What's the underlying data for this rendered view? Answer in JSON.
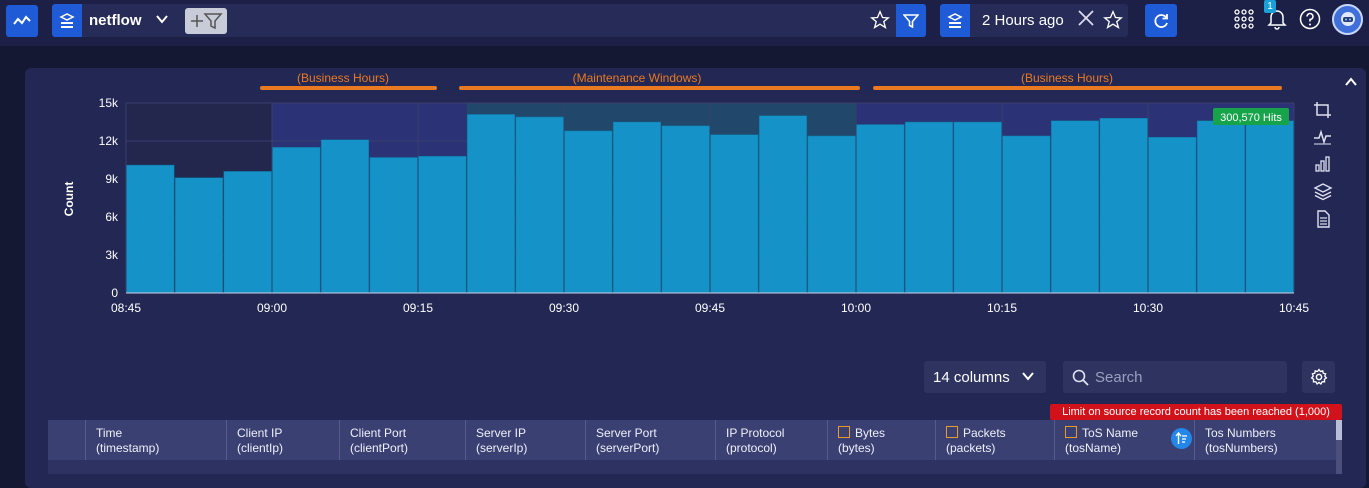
{
  "topbar": {
    "datasource": "netflow",
    "time_range": "2 Hours ago",
    "notification_count": "1"
  },
  "chart_data": {
    "type": "bar",
    "categories": [
      "08:45",
      "08:50",
      "08:55",
      "09:00",
      "09:05",
      "09:10",
      "09:15",
      "09:20",
      "09:25",
      "09:30",
      "09:35",
      "09:40",
      "09:45",
      "09:50",
      "09:55",
      "10:00",
      "10:05",
      "10:10",
      "10:15",
      "10:20",
      "10:25",
      "10:30",
      "10:35",
      "10:40"
    ],
    "values": [
      10100,
      9100,
      9600,
      11500,
      12100,
      10700,
      10800,
      14100,
      13900,
      12800,
      13500,
      13200,
      12500,
      14000,
      12400,
      13300,
      13500,
      13500,
      12400,
      13600,
      13800,
      12300,
      13600,
      13600
    ],
    "x_tick_labels": [
      "08:45",
      "09:00",
      "09:15",
      "09:30",
      "09:45",
      "10:00",
      "10:15",
      "10:30",
      "10:45"
    ],
    "y_tick_labels": [
      "0",
      "3k",
      "6k",
      "9k",
      "12k",
      "15k"
    ],
    "ylabel": "Count",
    "ylim": [
      0,
      15000
    ],
    "hits_label": "300,570 Hits",
    "bands": [
      {
        "label": "(Business Hours)",
        "type": "business",
        "from": "09:00",
        "to": "09:20"
      },
      {
        "label": "(Maintenance Windows)",
        "type": "maintenance",
        "from": "09:20",
        "to": "10:00"
      },
      {
        "label": "(Business Hours)",
        "type": "business",
        "from": "10:00",
        "to": "10:45"
      }
    ],
    "colors": {
      "bar": "#1592c7",
      "business": "#2b3276",
      "maintenance": "#21476a",
      "annotation": "#e97a22"
    }
  },
  "table_controls": {
    "columns_label": "14 columns",
    "search_placeholder": "Search",
    "limit_warning": "Limit on source record count has been reached (1,000)"
  },
  "table": {
    "columns": [
      {
        "name": "",
        "field": ""
      },
      {
        "name": "Time",
        "field": "(timestamp)"
      },
      {
        "name": "Client IP",
        "field": "(clientIp)"
      },
      {
        "name": "Client Port",
        "field": "(clientPort)"
      },
      {
        "name": "Server IP",
        "field": "(serverIp)"
      },
      {
        "name": "Server Port",
        "field": "(serverPort)"
      },
      {
        "name": "IP Protocol",
        "field": "(protocol)"
      },
      {
        "name": "Bytes",
        "field": "(bytes)",
        "numeric": true
      },
      {
        "name": "Packets",
        "field": "(packets)",
        "numeric": true
      },
      {
        "name": "ToS Name",
        "field": "(tosName)",
        "numeric": true
      },
      {
        "name": "Tos Numbers",
        "field": "(tosNumbers)"
      }
    ]
  }
}
